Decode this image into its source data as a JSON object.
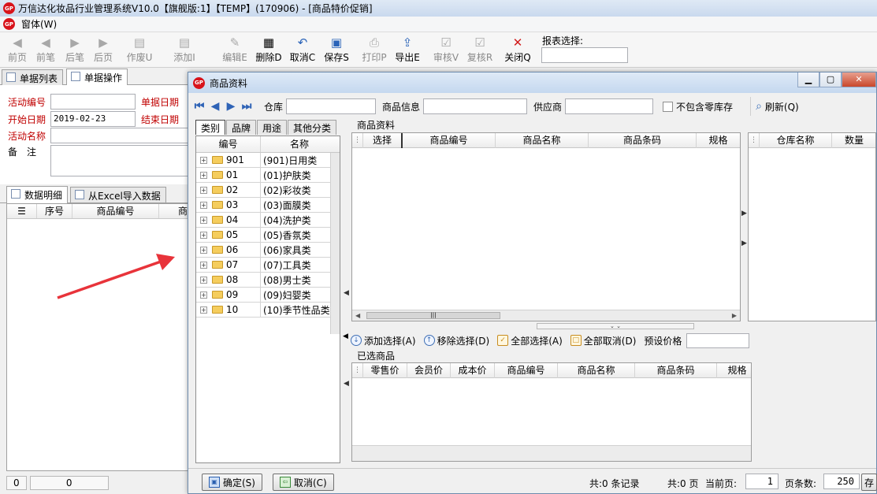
{
  "app": {
    "title": "万信达化妆品行业管理系统V10.0【旗舰版:1】【TEMP】(170906) - [商品特价促销]",
    "logo_text": "GP",
    "menu": "窗体(W)"
  },
  "toolbar": {
    "buttons": [
      {
        "label": "前页"
      },
      {
        "label": "前笔"
      },
      {
        "label": "后笔"
      },
      {
        "label": "后页"
      },
      {
        "label": "作废U"
      },
      {
        "label": "添加I"
      },
      {
        "label": "编辑E"
      },
      {
        "label": "删除D"
      },
      {
        "label": "取消C"
      },
      {
        "label": "保存S"
      },
      {
        "label": "打印P"
      },
      {
        "label": "导出E"
      },
      {
        "label": "审核V"
      },
      {
        "label": "复核R"
      },
      {
        "label": "关闭Q"
      }
    ],
    "report_label": "报表选择:"
  },
  "form": {
    "tab_list": "单据列表",
    "tab_ops": "单据操作",
    "activity_no_label": "活动编号",
    "doc_date_label": "单据日期",
    "start_date_label": "开始日期",
    "start_date_value": "2019-02-23",
    "end_date_label": "结束日期",
    "activity_name_label": "活动名称",
    "remark_label": "备　注",
    "detail_tab": "数据明细",
    "excel_tab": "从Excel导入数据",
    "grid_cols": [
      "序号",
      "商品编号",
      "商"
    ],
    "status_left": "0",
    "status_right": "0"
  },
  "dialog": {
    "title": "商品资料",
    "logo_text": "GP",
    "filter": {
      "warehouse_label": "仓库",
      "product_info_label": "商品信息",
      "supplier_label": "供应商",
      "exclude_zero_label": "不包含零库存",
      "refresh_label": "刷新(Q)"
    },
    "cat_tabs": [
      "类别",
      "品牌",
      "用途",
      "其他分类"
    ],
    "tree": {
      "head_code": "编号",
      "head_name": "名称",
      "rows": [
        {
          "code": "901",
          "name": "(901)日用类"
        },
        {
          "code": "01",
          "name": "(01)护肤类"
        },
        {
          "code": "02",
          "name": "(02)彩妆类"
        },
        {
          "code": "03",
          "name": "(03)面膜类"
        },
        {
          "code": "04",
          "name": "(04)洗护类"
        },
        {
          "code": "05",
          "name": "(05)香氛类"
        },
        {
          "code": "06",
          "name": "(06)家具类"
        },
        {
          "code": "07",
          "name": "(07)工具类"
        },
        {
          "code": "08",
          "name": "(08)男士类"
        },
        {
          "code": "09",
          "name": "(09)妇婴类"
        },
        {
          "code": "10",
          "name": "(10)季节性品类"
        }
      ]
    },
    "product_section": "商品资料",
    "product_cols": [
      "选择",
      "商品编号",
      "商品名称",
      "商品条码",
      "规格"
    ],
    "stock_cols": [
      "仓库名称",
      "数量"
    ],
    "actions": {
      "add": "添加选择(A)",
      "remove": "移除选择(D)",
      "select_all": "全部选择(A)",
      "cancel_all": "全部取消(D)",
      "preset_price": "预设价格"
    },
    "selected_section": "已选商品",
    "selected_cols": [
      "零售价",
      "会员价",
      "成本价",
      "商品编号",
      "商品名称",
      "商品条码",
      "规格"
    ],
    "footer": {
      "ok": "确定(S)",
      "cancel": "取消(C)",
      "records": "共:0 条记录",
      "pages": "共:0 页",
      "current_page_label": "当前页:",
      "current_page": "1",
      "page_size_label": "页条数:",
      "page_size": "250",
      "save": "存"
    }
  }
}
